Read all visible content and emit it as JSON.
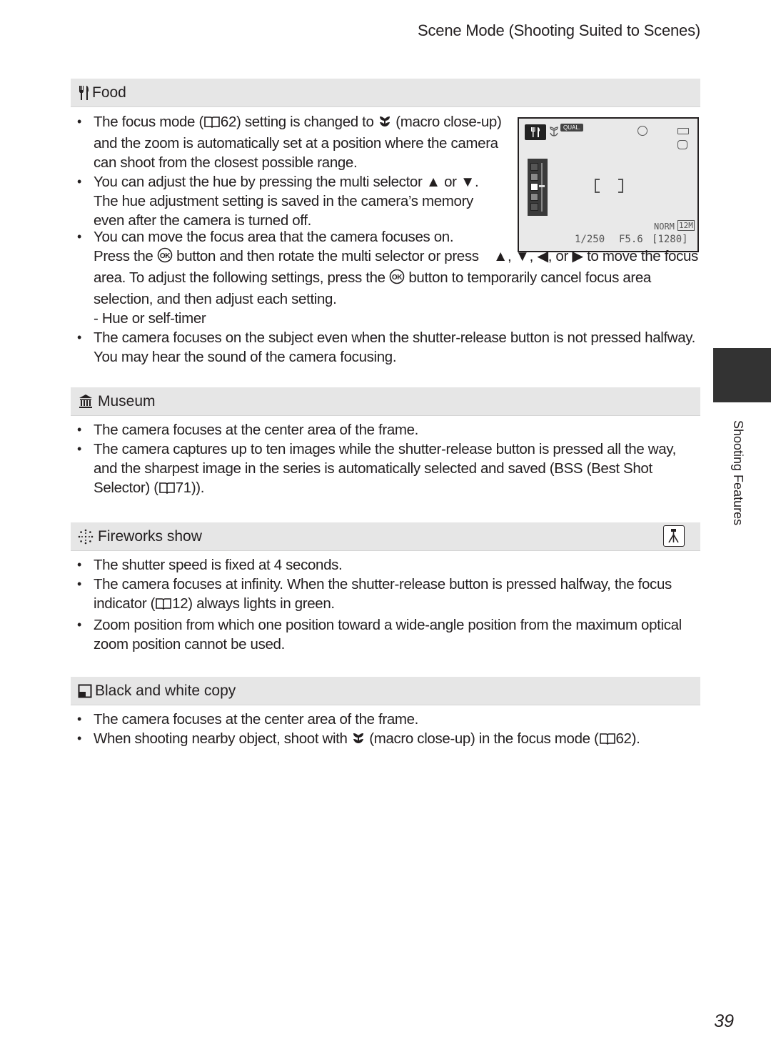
{
  "header": {
    "title": "Scene Mode (Shooting Suited to Scenes)"
  },
  "side_tab": {
    "label": "Shooting Features"
  },
  "page_number": "39",
  "sections": {
    "food": {
      "title": "Food",
      "icon": "fork-knife-icon",
      "b1": {
        "a": "The focus mode (",
        "ref": "62",
        "b": ") setting is changed to ",
        "c": " (macro close-up) and the zoom is automatically set at a position where the camera can shoot from the closest possible range."
      },
      "b2": {
        "a": "You can adjust the hue by pressing the multi selector ",
        "up": "▲",
        "b": " or ",
        "down": "▼",
        "c": ". The hue adjustment setting is saved in the camera’s memory even after the camera is turned off."
      },
      "b3": {
        "a": "You can move the focus area that the camera focuses on. Press the ",
        "ok": "OK",
        "b": " button and then rotate the multi selector or press ",
        "up": "▲",
        "c": ", ",
        "down": "▼",
        "d": ", ",
        "left": "◀",
        "e": ", or ",
        "right": "▶",
        "f": " to move the focus area. To adjust the following settings, press the ",
        "g": " button to temporarily cancel focus area selection, and then adjust each setting."
      },
      "sub1": "-  Hue or self-timer",
      "b4": "The camera focuses on the subject even when the shutter-release button is not pressed halfway. You may hear the sound of the camera focusing.",
      "lcd": {
        "qual_label": "QUAL.",
        "shutter": "1/250",
        "aperture": "F5.6",
        "remaining": "1280",
        "quality": "NORM",
        "image_size": "12M",
        "hue_level": 3,
        "hue_levels": 5
      }
    },
    "museum": {
      "title": "Museum",
      "icon": "museum-icon",
      "b1": "The camera focuses at the center area of the frame.",
      "b2": {
        "a": "The camera captures up to ten images while the shutter-release button is pressed all the way, and the sharpest image in the series is automatically selected and saved (BSS (Best Shot Selector) (",
        "ref": "71",
        "b": "))."
      }
    },
    "fireworks": {
      "title": "Fireworks show",
      "icon": "fireworks-icon",
      "badge_icon": "tripod-icon",
      "b1": "The shutter speed is fixed at 4 seconds.",
      "b2": {
        "a": "The camera focuses at infinity. When the shutter-release button is pressed halfway, the focus indicator (",
        "ref": "12",
        "b": ") always lights in green."
      },
      "b3": "Zoom position from which one position toward a wide-angle position from the maximum optical zoom position cannot be used."
    },
    "bw_copy": {
      "title": "Black and white copy",
      "icon": "black-white-copy-icon",
      "b1": "The camera focuses at the center area of the frame.",
      "b2": {
        "a": "When shooting nearby object, shoot with ",
        "b": " (macro close-up) in the focus mode (",
        "ref": "62",
        "c": ")."
      }
    }
  }
}
